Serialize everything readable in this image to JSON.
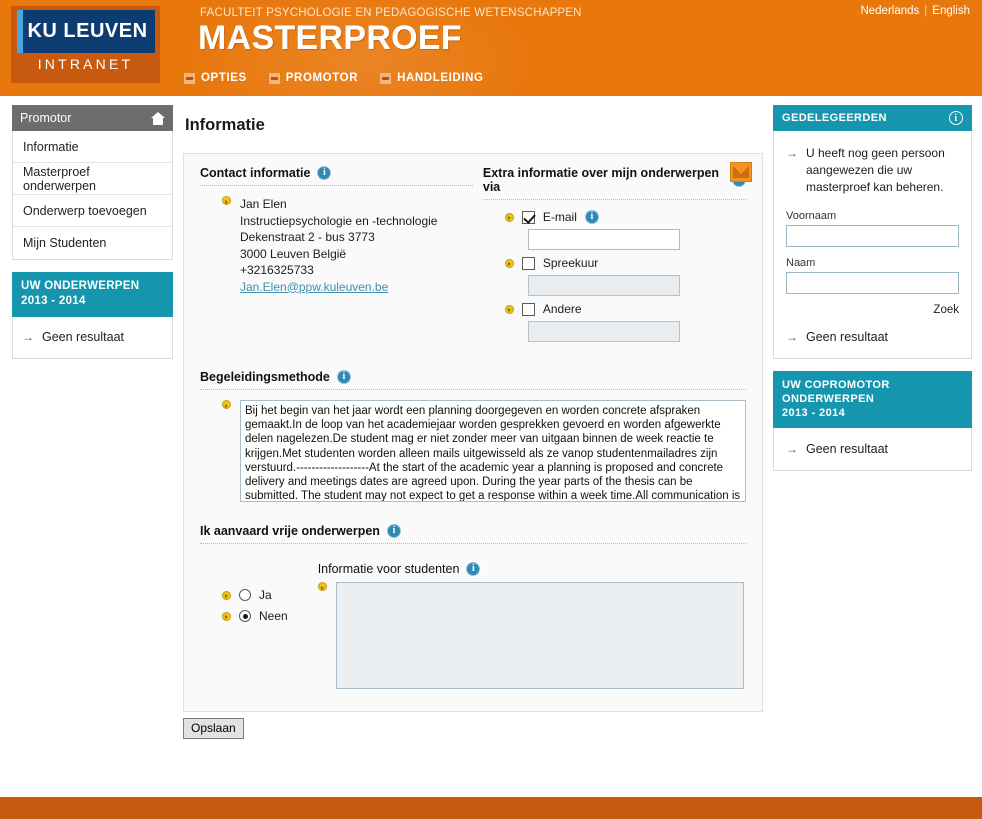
{
  "header": {
    "logo_main": "KU LEUVEN",
    "logo_sub": "INTRANET",
    "faculty": "FACULTEIT PSYCHOLOGIE EN PEDAGOGISCHE WETENSCHAPPEN",
    "app_title": "MASTERPROEF",
    "nav": [
      {
        "label": "OPTIES",
        "icon": "square-menu-icon"
      },
      {
        "label": "PROMOTOR",
        "icon": "square-menu-icon"
      },
      {
        "label": "HANDLEIDING",
        "icon": "square-menu-icon"
      }
    ],
    "lang": {
      "nl": "Nederlands",
      "sep": "|",
      "en": "English"
    }
  },
  "sidebar": {
    "title": "Promotor",
    "home_icon": "home-icon",
    "items": [
      {
        "label": "Informatie"
      },
      {
        "label": "Masterproef onderwerpen"
      },
      {
        "label": "Onderwerp toevoegen"
      },
      {
        "label": "Mijn Studenten"
      }
    ],
    "box": {
      "title_line1": "UW ONDERWERPEN",
      "title_line2": "2013 - 2014",
      "result": "Geen resultaat",
      "arrow": "→"
    }
  },
  "main": {
    "page_title": "Informatie",
    "mail_button_icon": "envelope-icon",
    "contact": {
      "title": "Contact informatie",
      "info_icon": "info-icon",
      "name": "Jan Elen",
      "department": "Instructiepsychologie en -technologie",
      "street": "Dekenstraat 2 - bus 3773",
      "city": "3000 Leuven België",
      "phone": "+3216325733",
      "email": "Jan.Elen@ppw.kuleuven.be"
    },
    "extra": {
      "title": "Extra informatie over mijn onderwerpen via",
      "info_icon": "info-icon",
      "options": [
        {
          "label": "E-mail",
          "checked": true,
          "has_info": true,
          "value": "",
          "disabled": false
        },
        {
          "label": "Spreekuur",
          "checked": false,
          "has_info": false,
          "value": "",
          "disabled": true
        },
        {
          "label": "Andere",
          "checked": false,
          "has_info": false,
          "value": "",
          "disabled": true
        }
      ]
    },
    "method": {
      "title": "Begeleidingsmethode",
      "info_icon": "info-icon",
      "text": "Bij het begin van het jaar wordt een planning doorgegeven en worden concrete afspraken gemaakt.In de loop van het academiejaar worden gesprekken gevoerd en worden afgewerkte delen nagelezen.De student mag er niet zonder meer van uitgaan binnen de week reactie te krijgen.Met studenten worden alleen mails uitgewisseld als ze vanop studentenmailadres zijn verstuurd.-------------------At the start of the academic year a planning is proposed and concrete delivery and meetings dates are agreed upon. During the year parts of the thesis can be submitted. The student may not expect to get a response within a week time.All communication is through a valid student-email address.The final version is read maximum two times."
    },
    "free_topics": {
      "title": "Ik aanvaard vrije onderwerpen",
      "info_icon": "info-icon",
      "radios": [
        {
          "label": "Ja",
          "selected": false
        },
        {
          "label": "Neen",
          "selected": true
        }
      ],
      "student_info_label": "Informatie voor studenten",
      "student_info_value": "",
      "student_info_disabled": true
    },
    "save_label": "Opslaan"
  },
  "right_panel": {
    "delegates": {
      "title": "GEDELEGEERDEN",
      "info_icon": "info-icon",
      "arrow": "→",
      "message": "U heeft nog geen persoon aangewezen die uw masterproef kan beheren.",
      "firstname_label": "Voornaam",
      "firstname_value": "",
      "lastname_label": "Naam",
      "lastname_value": "",
      "search_label": "Zoek",
      "result": "Geen resultaat"
    },
    "copromotor": {
      "title_line1": "UW COPROMOTOR ONDERWERPEN",
      "title_line2": "2013 - 2014",
      "arrow": "→",
      "result": "Geen resultaat"
    }
  },
  "colors": {
    "orange": "#e8770c",
    "orange_dark": "#c85a10",
    "teal": "#1596ae",
    "navy": "#0d3c72",
    "gray_head": "#6d6d6d"
  }
}
